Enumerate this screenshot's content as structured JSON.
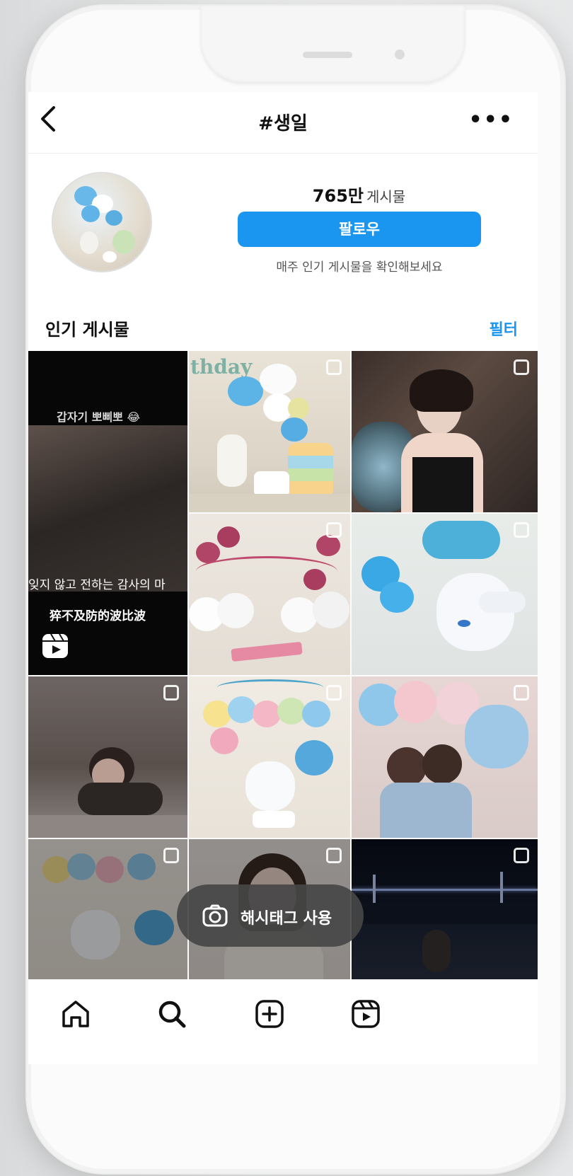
{
  "header": {
    "title": "#생일"
  },
  "profile": {
    "post_count": "765만",
    "post_label": "게시물",
    "follow_label": "팔로우",
    "subtitle": "매주 인기 게시물을 확인해보세요"
  },
  "section": {
    "heading": "인기 게시물",
    "filter_label": "필터"
  },
  "tiles": [
    {
      "overlay_top": "갑자기 뽀삐뽀 😂",
      "overlay_caption": "잊지 않고 전하는 감사의 마",
      "overlay_chinese": "猝不及防的波比波"
    },
    {
      "overlay_top": "thday"
    },
    {},
    {},
    {},
    {},
    {},
    {},
    {},
    {},
    {},
    {}
  ],
  "hashtag_button": {
    "label": "해시태그 사용"
  },
  "colors": {
    "accent": "#1a96f0"
  }
}
